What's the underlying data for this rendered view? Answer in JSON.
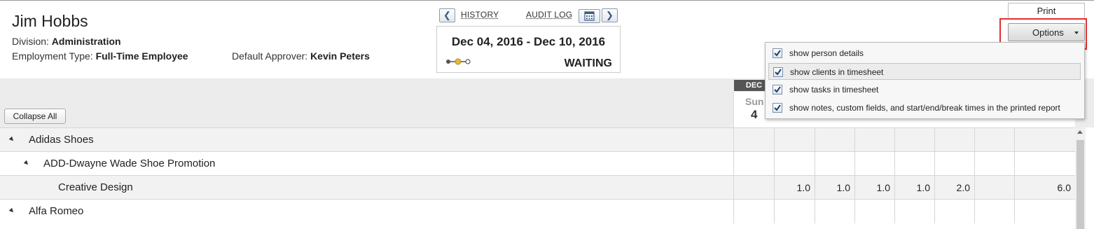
{
  "person": {
    "name": "Jim Hobbs",
    "division_label": "Division:",
    "division": "Administration",
    "employment_label": "Employment Type:",
    "employment": "Full-Time Employee",
    "approver_label": "Default Approver:",
    "approver": "Kevin Peters"
  },
  "nav": {
    "prev_icon": "chevron-left-icon",
    "next_icon": "chevron-right-icon",
    "calendar_icon": "calendar-icon",
    "history": "HISTORY",
    "audit_log": "AUDIT LOG"
  },
  "period": {
    "range": "Dec 04, 2016 - Dec 10, 2016",
    "status": "WAITING",
    "progress_step": 2,
    "progress_total": 3
  },
  "toolbar": {
    "print": "Print",
    "options": "Options",
    "collapse_all": "Collapse All"
  },
  "options_menu": [
    {
      "label": "show person details",
      "checked": true
    },
    {
      "label": "show clients in timesheet",
      "checked": true
    },
    {
      "label": "show tasks in timesheet",
      "checked": true
    },
    {
      "label": "show notes, custom fields, and start/end/break times in the printed report",
      "checked": true
    }
  ],
  "calendar": {
    "month": "DEC",
    "first_day_name": "Sun",
    "first_day_number": "4"
  },
  "rows": [
    {
      "label": "Adidas Shoes",
      "level": 0,
      "expanded": true,
      "values": [
        "",
        "",
        "",
        "",
        "",
        "",
        "",
        ""
      ]
    },
    {
      "label": "ADD-Dwayne Wade Shoe Promotion",
      "level": 1,
      "expanded": true,
      "values": [
        "",
        "",
        "",
        "",
        "",
        "",
        "",
        ""
      ]
    },
    {
      "label": "Creative Design",
      "level": 2,
      "values": [
        "",
        "1.0",
        "1.0",
        "1.0",
        "1.0",
        "2.0",
        "",
        "6.0"
      ]
    },
    {
      "label": "Alfa Romeo",
      "level": 0,
      "expanded": true,
      "values": [
        "",
        "",
        "",
        "",
        "",
        "",
        "",
        ""
      ]
    }
  ],
  "colors": {
    "highlight": "#e03030",
    "accent": "#3a5a85",
    "progress_active": "#e8b73a"
  }
}
